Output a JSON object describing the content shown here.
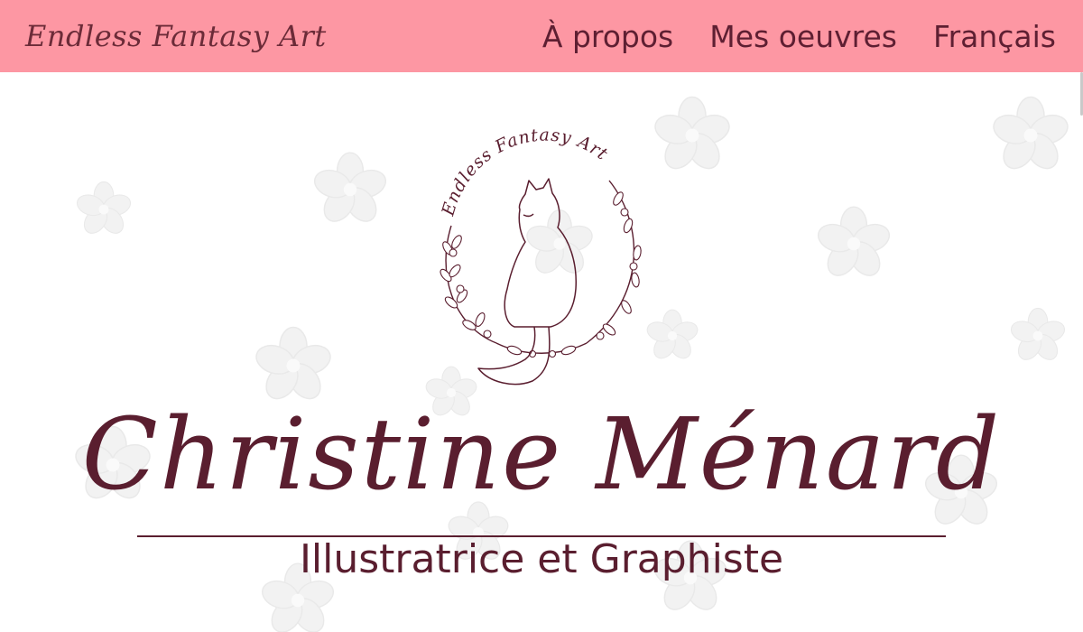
{
  "navbar": {
    "brand": "Endless Fantasy Art",
    "links": [
      "À propos",
      "Mes oeuvres",
      "Français"
    ]
  },
  "logo": {
    "arc_text": "Endless Fantasy Art",
    "icon": "cat-in-wreath-icon"
  },
  "hero": {
    "name": "Christine Ménard",
    "subtitle": "Illustratrice et Graphiste"
  },
  "colors": {
    "navbar_bg": "#fd97a3",
    "text_primary": "#5a1e2f",
    "flower": "#f1f1f1"
  }
}
